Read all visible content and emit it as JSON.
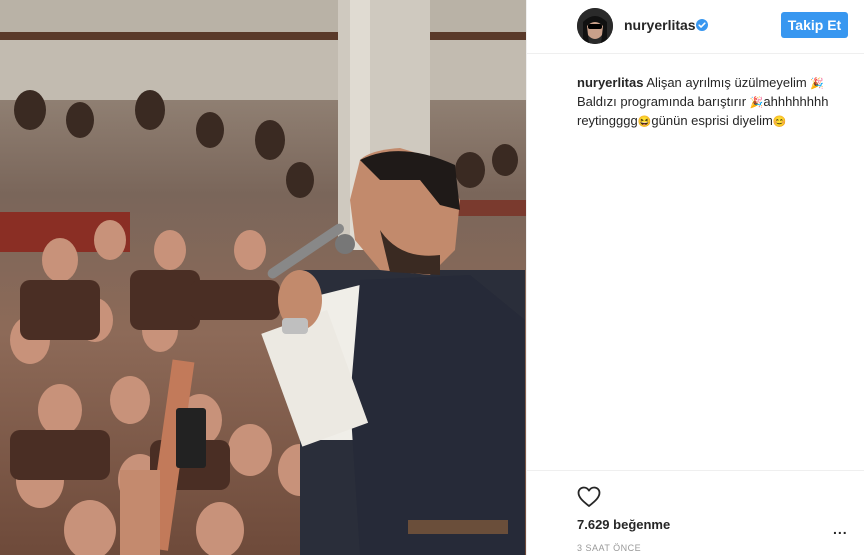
{
  "post": {
    "username": "nuryerlitas",
    "verified_icon": "verified-badge-icon",
    "follow_label": "Takip Et",
    "caption_username": "nuryerlitas",
    "caption_line1": " Alişan ayrılmış üzülmeyelim ",
    "caption_line2": "Baldızı programında barıştırır ",
    "caption_line2b": "ahhhhhhhh",
    "caption_line3": "reytingggg",
    "caption_line3b": "günün esprisi diyelim",
    "emoji_1": "🎉",
    "emoji_2": "🎉",
    "emoji_3": "😆",
    "emoji_4": "😊",
    "likes": "7.629 beğenme",
    "time": "3 SAAT ÖNCE",
    "more_label": "..."
  },
  "colors": {
    "accent": "#3897f0",
    "text": "#262626",
    "muted": "#999999",
    "border": "#efefef"
  }
}
